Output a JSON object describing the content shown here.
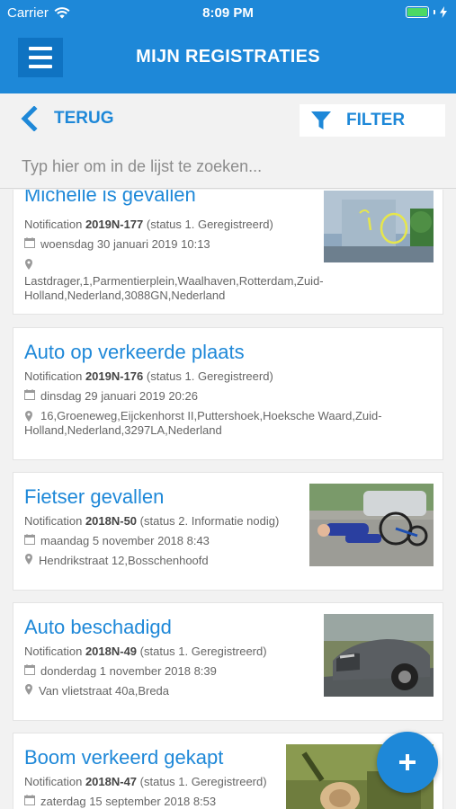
{
  "status": {
    "carrier": "Carrier",
    "time": "8:09 PM"
  },
  "header": {
    "title": "MIJN REGISTRATIES"
  },
  "nav": {
    "back_label": "TERUG",
    "filter_label": "FILTER"
  },
  "search": {
    "placeholder": "Typ hier om in de lijst te zoeken..."
  },
  "items": [
    {
      "title": "Michelle is gevallen",
      "prefix": "Notification",
      "number": "2019N-177",
      "status": "(status 1. Geregistreerd)",
      "date": "woensdag 30 januari 2019 10:13",
      "address": "Lastdrager,1,Parmentierplein,Waalhaven,Rotterdam,Zuid-Holland,Nederland,3088GN,Nederland"
    },
    {
      "title": "Auto op verkeerde plaats",
      "prefix": "Notification",
      "number": "2019N-176",
      "status": "(status 1. Geregistreerd)",
      "date": "dinsdag 29 januari 2019 20:26",
      "address": "16,Groeneweg,Eijckenhorst II,Puttershoek,Hoeksche Waard,Zuid-Holland,Nederland,3297LA,Nederland"
    },
    {
      "title": "Fietser gevallen",
      "prefix": "Notification",
      "number": "2018N-50",
      "status": "(status 2. Informatie nodig)",
      "date": "maandag 5 november 2018 8:43",
      "address": "Hendrikstraat 12,Bosschenhoofd"
    },
    {
      "title": "Auto beschadigd",
      "prefix": "Notification",
      "number": "2018N-49",
      "status": "(status 1. Geregistreerd)",
      "date": "donderdag 1 november 2018 8:39",
      "address": "Van vlietstraat 40a,Breda"
    },
    {
      "title": "Boom verkeerd gekapt",
      "prefix": "Notification",
      "number": "2018N-47",
      "status": "(status 1. Geregistreerd)",
      "date": "zaterdag 15 september 2018 8:53"
    }
  ],
  "fab": {
    "label": "+"
  },
  "colors": {
    "primary": "#1e88d8",
    "header_button": "#0f73c2",
    "background": "#f2f2f2",
    "battery": "#4cd964"
  }
}
